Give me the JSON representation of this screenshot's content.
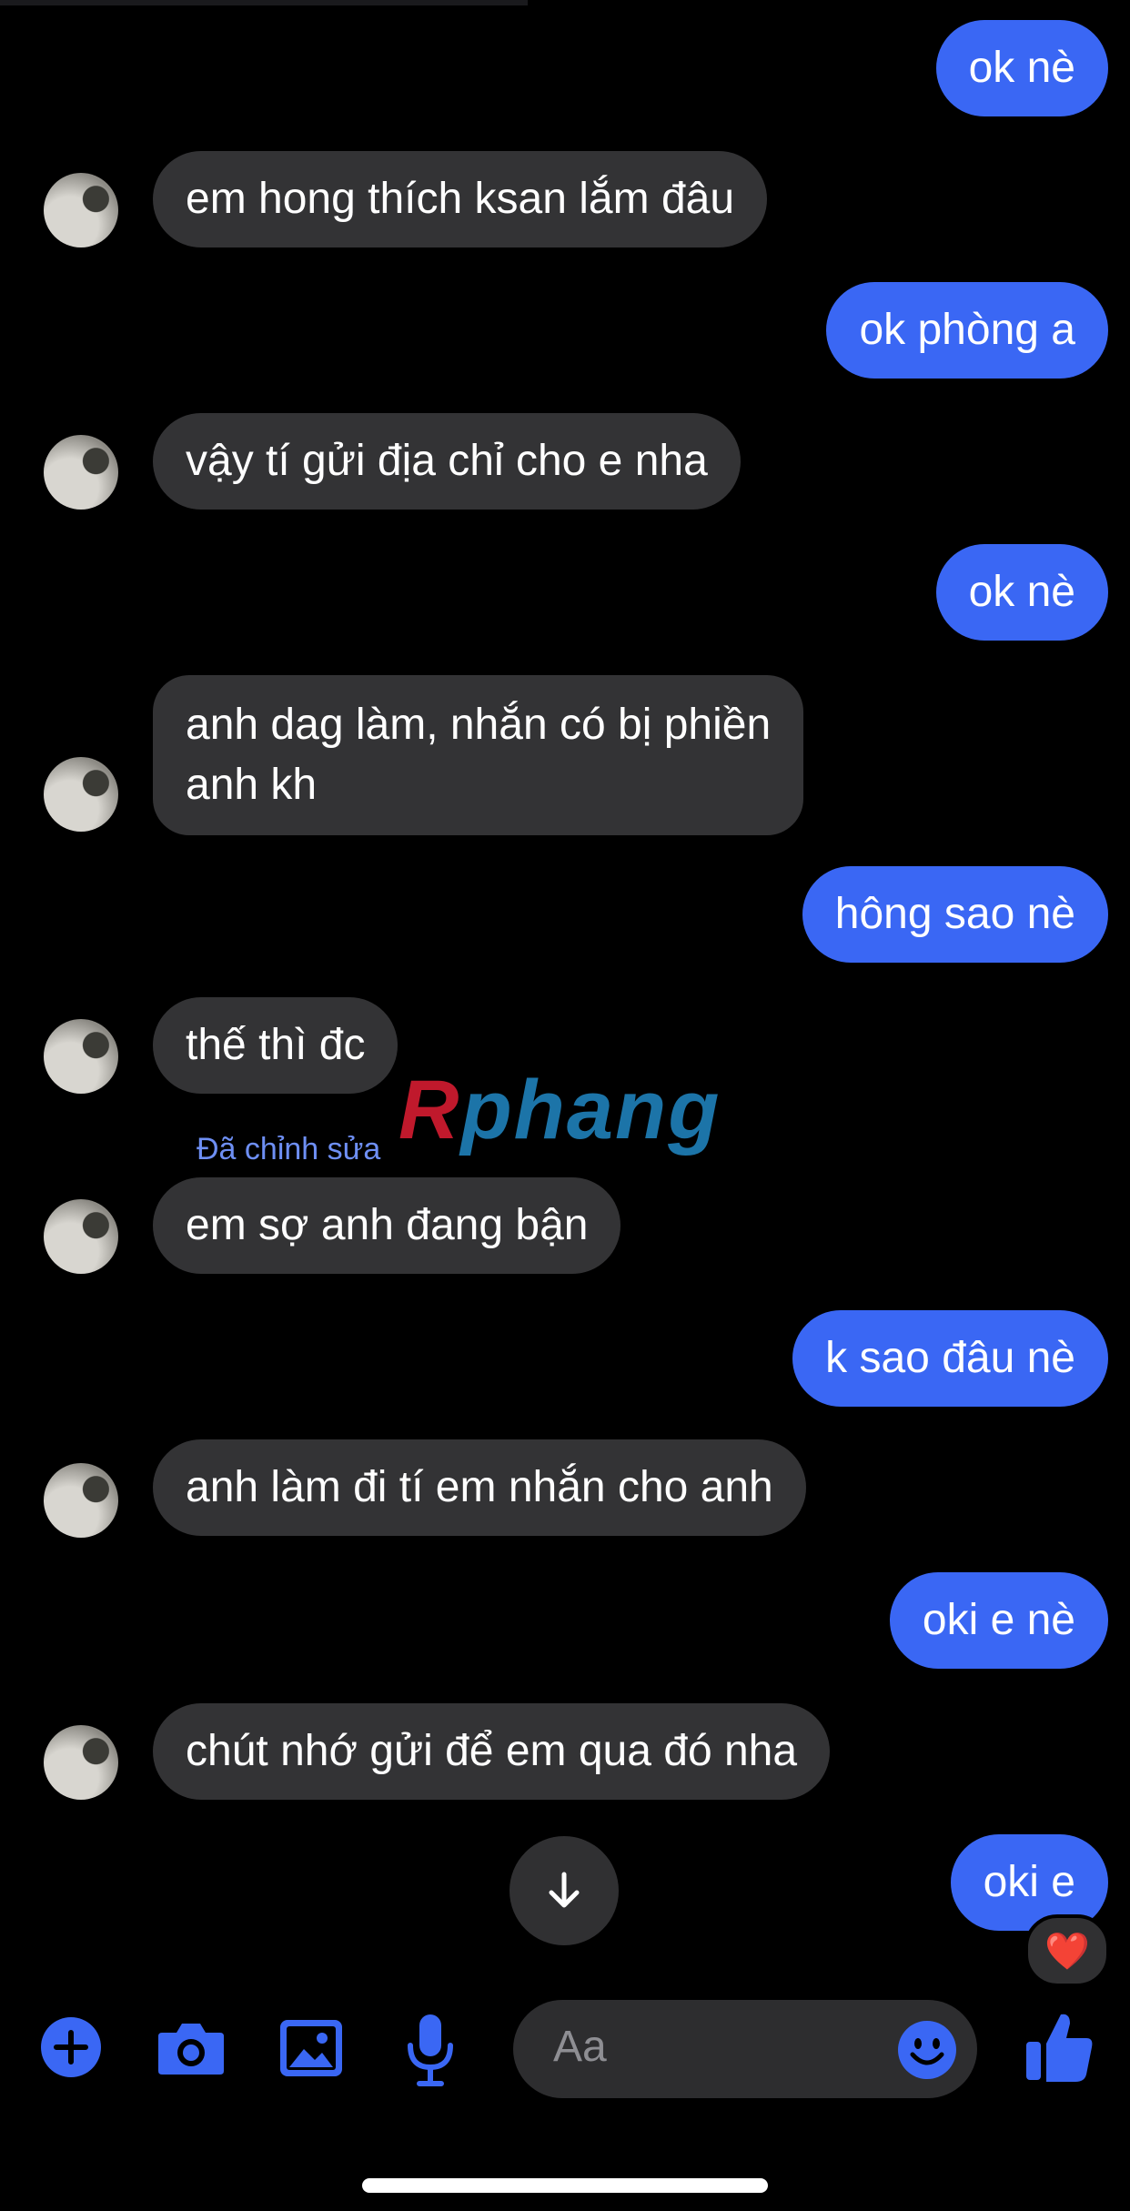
{
  "messages": [
    {
      "dir": "out",
      "text": "ok nè"
    },
    {
      "dir": "in",
      "text": "em hong thích ksan lắm đâu"
    },
    {
      "dir": "out",
      "text": "ok phòng a"
    },
    {
      "dir": "in",
      "text": "vậy tí gửi địa chỉ cho e nha"
    },
    {
      "dir": "out",
      "text": "ok nè"
    },
    {
      "dir": "in",
      "text_line1": "anh dag làm, nhắn có bị phiền",
      "text_line2": "anh kh"
    },
    {
      "dir": "out",
      "text": "hông sao nè"
    },
    {
      "dir": "in",
      "text": "thế thì đc"
    },
    {
      "dir": "in",
      "text": "em sợ anh đang bận",
      "edited_label": "Đã chỉnh sửa"
    },
    {
      "dir": "out",
      "text": "k sao đâu nè"
    },
    {
      "dir": "in",
      "text": "anh làm đi tí em nhắn cho anh"
    },
    {
      "dir": "out",
      "text": "oki e nè"
    },
    {
      "dir": "in",
      "text": "chút nhớ gửi để em qua đó nha"
    },
    {
      "dir": "out",
      "text": "oki e",
      "reaction": "❤️"
    }
  ],
  "watermark": {
    "first": "R",
    "rest": "phang"
  },
  "composer": {
    "placeholder": "Aa"
  },
  "icons": {
    "add": "plus-circle-icon",
    "camera": "camera-icon",
    "gallery": "image-icon",
    "mic": "microphone-icon",
    "emoji": "smiley-icon",
    "like": "thumbs-up-icon",
    "scroll": "arrow-down-icon"
  },
  "colors": {
    "accent": "#3a67f4",
    "incoming_bubble": "#333335",
    "background": "#000000",
    "edited_label": "#6e8ff4"
  }
}
